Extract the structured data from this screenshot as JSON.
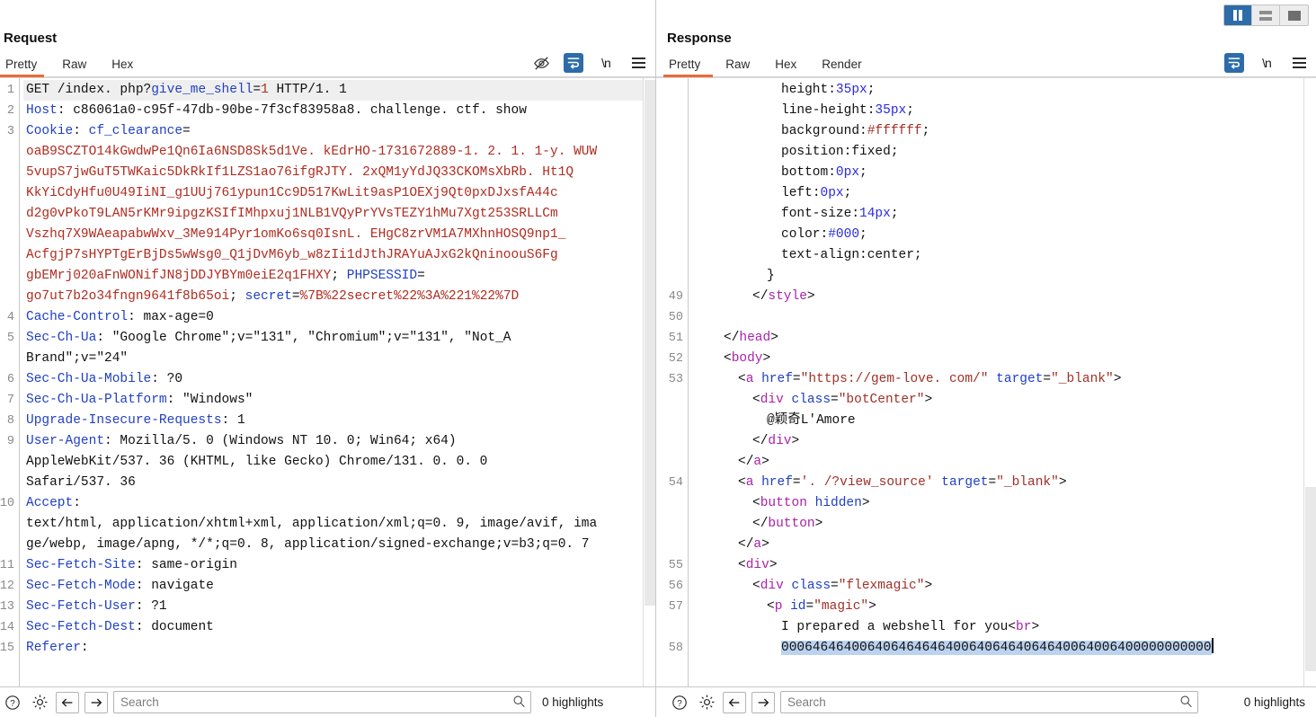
{
  "layout_buttons": [
    {
      "name": "vertical-split",
      "active": true
    },
    {
      "name": "horizontal-split",
      "active": false
    },
    {
      "name": "single-pane",
      "active": false
    }
  ],
  "request": {
    "title": "Request",
    "tabs": [
      {
        "label": "Pretty",
        "active": true
      },
      {
        "label": "Raw",
        "active": false
      },
      {
        "label": "Hex",
        "active": false
      }
    ],
    "toolbar_icons": [
      "eye-off-icon",
      "word-wrap-icon",
      "newline-icon",
      "menu-icon"
    ],
    "newline_label": "\\n",
    "bottom": {
      "search_value": "",
      "search_placeholder": "Search",
      "highlights": "0 highlights"
    },
    "lines": [
      {
        "num": "1",
        "highlight": true,
        "parts": [
          {
            "t": "GET /index. php?",
            "c": "k-plain"
          },
          {
            "t": "give_me_shell",
            "c": "k-blue"
          },
          {
            "t": "=",
            "c": "k-plain"
          },
          {
            "t": "1",
            "c": "k-red"
          },
          {
            "t": " HTTP/1. 1",
            "c": "k-plain"
          }
        ]
      },
      {
        "num": "2",
        "parts": [
          {
            "t": "Host",
            "c": "k-hdr"
          },
          {
            "t": ": c86061a0-c95f-47db-90be-7f3cf83958a8. challenge. ctf. show",
            "c": "k-plain"
          }
        ]
      },
      {
        "num": "3",
        "parts": [
          {
            "t": "Cookie",
            "c": "k-hdr"
          },
          {
            "t": ": ",
            "c": "k-plain"
          },
          {
            "t": "cf_clearance",
            "c": "k-blue"
          },
          {
            "t": "=",
            "c": "k-plain"
          }
        ]
      },
      {
        "num": "",
        "parts": [
          {
            "t": "oaB9SCZTO14kGwdwPe1Qn6Ia6NSD8Sk5d1Ve. kEdrHO-1731672889-1. 2. 1. 1-y. WUW",
            "c": "k-red"
          }
        ]
      },
      {
        "num": "",
        "parts": [
          {
            "t": "5vupS7jwGuT5TWKaic5DkRkIf1LZS1ao76ifgRJTY. 2xQM1yYdJQ33CKOMsXbRb. Ht1Q",
            "c": "k-red"
          }
        ]
      },
      {
        "num": "",
        "parts": [
          {
            "t": "KkYiCdyHfu0U49IiNI_g1UUj761ypun1Cc9D517KwLit9asP1OEXj9Qt0pxDJxsfA44c",
            "c": "k-red"
          }
        ]
      },
      {
        "num": "",
        "parts": [
          {
            "t": "d2g0vPkoT9LAN5rKMr9ipgzKSIfIMhpxuj1NLB1VQyPrYVsTEZY1hMu7Xgt253SRLLCm",
            "c": "k-red"
          }
        ]
      },
      {
        "num": "",
        "parts": [
          {
            "t": "Vszhq7X9WAeapabwWxv_3Me914Pyr1omKo6sq0IsnL. EHgC8zrVM1A7MXhnHOSQ9np1_",
            "c": "k-red"
          }
        ]
      },
      {
        "num": "",
        "parts": [
          {
            "t": "AcfgjP7sHYPTgErBjDs5wWsg0_Q1jDvM6yb_w8zIi1dJthJRAYuAJxG2kQninoouS6Fg",
            "c": "k-red"
          }
        ]
      },
      {
        "num": "",
        "parts": [
          {
            "t": "gbEMrj020aFnWONifJN8jDDJYBYm0eiE2q1FHXY",
            "c": "k-red"
          },
          {
            "t": "; ",
            "c": "k-plain"
          },
          {
            "t": "PHPSESSID",
            "c": "k-blue"
          },
          {
            "t": "=",
            "c": "k-plain"
          }
        ]
      },
      {
        "num": "",
        "parts": [
          {
            "t": "go7ut7b2o34fngn9641f8b65oi",
            "c": "k-red"
          },
          {
            "t": "; ",
            "c": "k-plain"
          },
          {
            "t": "secret",
            "c": "k-blue"
          },
          {
            "t": "=",
            "c": "k-plain"
          },
          {
            "t": "%7B%22secret%22%3A%221%22%7D",
            "c": "k-red"
          }
        ]
      },
      {
        "num": "4",
        "parts": [
          {
            "t": "Cache-Control",
            "c": "k-hdr"
          },
          {
            "t": ": max-age=0",
            "c": "k-plain"
          }
        ]
      },
      {
        "num": "5",
        "parts": [
          {
            "t": "Sec-Ch-Ua",
            "c": "k-hdr"
          },
          {
            "t": ": \"Google Chrome\";v=\"131\", \"Chromium\";v=\"131\", \"Not_A",
            "c": "k-plain"
          }
        ]
      },
      {
        "num": "",
        "parts": [
          {
            "t": "Brand\";v=\"24\"",
            "c": "k-plain"
          }
        ]
      },
      {
        "num": "6",
        "parts": [
          {
            "t": "Sec-Ch-Ua-Mobile",
            "c": "k-hdr"
          },
          {
            "t": ": ?0",
            "c": "k-plain"
          }
        ]
      },
      {
        "num": "7",
        "parts": [
          {
            "t": "Sec-Ch-Ua-Platform",
            "c": "k-hdr"
          },
          {
            "t": ": \"Windows\"",
            "c": "k-plain"
          }
        ]
      },
      {
        "num": "8",
        "parts": [
          {
            "t": "Upgrade-Insecure-Requests",
            "c": "k-hdr"
          },
          {
            "t": ": 1",
            "c": "k-plain"
          }
        ]
      },
      {
        "num": "9",
        "parts": [
          {
            "t": "User-Agent",
            "c": "k-hdr"
          },
          {
            "t": ": Mozilla/5. 0 (Windows NT 10. 0; Win64; x64)",
            "c": "k-plain"
          }
        ]
      },
      {
        "num": "",
        "parts": [
          {
            "t": "AppleWebKit/537. 36 (KHTML, like Gecko) Chrome/131. 0. 0. 0",
            "c": "k-plain"
          }
        ]
      },
      {
        "num": "",
        "parts": [
          {
            "t": "Safari/537. 36",
            "c": "k-plain"
          }
        ]
      },
      {
        "num": "10",
        "parts": [
          {
            "t": "Accept",
            "c": "k-hdr"
          },
          {
            "t": ":",
            "c": "k-plain"
          }
        ]
      },
      {
        "num": "",
        "parts": [
          {
            "t": "text/html, application/xhtml+xml, application/xml;q=0. 9, image/avif, ima",
            "c": "k-plain"
          }
        ]
      },
      {
        "num": "",
        "parts": [
          {
            "t": "ge/webp, image/apng, */*;q=0. 8, application/signed-exchange;v=b3;q=0. 7",
            "c": "k-plain"
          }
        ]
      },
      {
        "num": "11",
        "parts": [
          {
            "t": "Sec-Fetch-Site",
            "c": "k-hdr"
          },
          {
            "t": ": same-origin",
            "c": "k-plain"
          }
        ]
      },
      {
        "num": "12",
        "parts": [
          {
            "t": "Sec-Fetch-Mode",
            "c": "k-hdr"
          },
          {
            "t": ": navigate",
            "c": "k-plain"
          }
        ]
      },
      {
        "num": "13",
        "parts": [
          {
            "t": "Sec-Fetch-User",
            "c": "k-hdr"
          },
          {
            "t": ": ?1",
            "c": "k-plain"
          }
        ]
      },
      {
        "num": "14",
        "parts": [
          {
            "t": "Sec-Fetch-Dest",
            "c": "k-hdr"
          },
          {
            "t": ": document",
            "c": "k-plain"
          }
        ]
      },
      {
        "num": "15",
        "parts": [
          {
            "t": "Referer",
            "c": "k-hdr"
          },
          {
            "t": ":",
            "c": "k-plain"
          }
        ]
      }
    ]
  },
  "response": {
    "title": "Response",
    "tabs": [
      {
        "label": "Pretty",
        "active": true
      },
      {
        "label": "Raw",
        "active": false
      },
      {
        "label": "Hex",
        "active": false
      },
      {
        "label": "Render",
        "active": false
      }
    ],
    "toolbar_icons": [
      "word-wrap-icon",
      "newline-icon",
      "menu-icon"
    ],
    "newline_label": "\\n",
    "bottom": {
      "search_value": "",
      "search_placeholder": "Search",
      "highlights": "0 highlights"
    },
    "lines": [
      {
        "num": "",
        "indent": 6,
        "parts": [
          {
            "t": "height",
            "c": "k-plain"
          },
          {
            "t": ":",
            "c": "k-punct"
          },
          {
            "t": "35px",
            "c": "k-num"
          },
          {
            "t": ";",
            "c": "k-punct"
          }
        ]
      },
      {
        "num": "",
        "indent": 6,
        "parts": [
          {
            "t": "line-height",
            "c": "k-plain"
          },
          {
            "t": ":",
            "c": "k-punct"
          },
          {
            "t": "35px",
            "c": "k-num"
          },
          {
            "t": ";",
            "c": "k-punct"
          }
        ]
      },
      {
        "num": "",
        "indent": 6,
        "parts": [
          {
            "t": "background",
            "c": "k-plain"
          },
          {
            "t": ":",
            "c": "k-punct"
          },
          {
            "t": "#ffffff",
            "c": "k-str"
          },
          {
            "t": ";",
            "c": "k-punct"
          }
        ]
      },
      {
        "num": "",
        "indent": 6,
        "parts": [
          {
            "t": "position",
            "c": "k-plain"
          },
          {
            "t": ":fixed;",
            "c": "k-punct"
          }
        ]
      },
      {
        "num": "",
        "indent": 6,
        "parts": [
          {
            "t": "bottom",
            "c": "k-plain"
          },
          {
            "t": ":",
            "c": "k-punct"
          },
          {
            "t": "0px",
            "c": "k-num"
          },
          {
            "t": ";",
            "c": "k-punct"
          }
        ]
      },
      {
        "num": "",
        "indent": 6,
        "parts": [
          {
            "t": "left",
            "c": "k-plain"
          },
          {
            "t": ":",
            "c": "k-punct"
          },
          {
            "t": "0px",
            "c": "k-num"
          },
          {
            "t": ";",
            "c": "k-punct"
          }
        ]
      },
      {
        "num": "",
        "indent": 6,
        "parts": [
          {
            "t": "font-size",
            "c": "k-plain"
          },
          {
            "t": ":",
            "c": "k-punct"
          },
          {
            "t": "14px",
            "c": "k-num"
          },
          {
            "t": ";",
            "c": "k-punct"
          }
        ]
      },
      {
        "num": "",
        "indent": 6,
        "parts": [
          {
            "t": "color",
            "c": "k-plain"
          },
          {
            "t": ":",
            "c": "k-punct"
          },
          {
            "t": "#000",
            "c": "k-num"
          },
          {
            "t": ";",
            "c": "k-punct"
          }
        ]
      },
      {
        "num": "",
        "indent": 6,
        "parts": [
          {
            "t": "text-align",
            "c": "k-plain"
          },
          {
            "t": ":center;",
            "c": "k-punct"
          }
        ]
      },
      {
        "num": "",
        "indent": 5,
        "parts": [
          {
            "t": "}",
            "c": "k-punct"
          }
        ]
      },
      {
        "num": "49",
        "indent": 4,
        "parts": [
          {
            "t": "</",
            "c": "k-punct"
          },
          {
            "t": "style",
            "c": "k-tag"
          },
          {
            "t": ">",
            "c": "k-punct"
          }
        ]
      },
      {
        "num": "50",
        "indent": 0,
        "parts": []
      },
      {
        "num": "51",
        "indent": 2,
        "parts": [
          {
            "t": "</",
            "c": "k-punct"
          },
          {
            "t": "head",
            "c": "k-tag"
          },
          {
            "t": ">",
            "c": "k-punct"
          }
        ]
      },
      {
        "num": "52",
        "indent": 2,
        "parts": [
          {
            "t": "<",
            "c": "k-punct"
          },
          {
            "t": "body",
            "c": "k-tag"
          },
          {
            "t": ">",
            "c": "k-punct"
          }
        ]
      },
      {
        "num": "53",
        "indent": 3,
        "parts": [
          {
            "t": "<",
            "c": "k-punct"
          },
          {
            "t": "a ",
            "c": "k-tag"
          },
          {
            "t": "href",
            "c": "k-attr"
          },
          {
            "t": "=",
            "c": "k-punct"
          },
          {
            "t": "\"https://gem-love. com/\"",
            "c": "k-str"
          },
          {
            "t": " ",
            "c": "k-punct"
          },
          {
            "t": "target",
            "c": "k-attr"
          },
          {
            "t": "=",
            "c": "k-punct"
          },
          {
            "t": "\"_blank\"",
            "c": "k-str"
          },
          {
            "t": ">",
            "c": "k-punct"
          }
        ]
      },
      {
        "num": "",
        "indent": 4,
        "parts": [
          {
            "t": "<",
            "c": "k-punct"
          },
          {
            "t": "div ",
            "c": "k-tag"
          },
          {
            "t": "class",
            "c": "k-attr"
          },
          {
            "t": "=",
            "c": "k-punct"
          },
          {
            "t": "\"botCenter\"",
            "c": "k-str"
          },
          {
            "t": ">",
            "c": "k-punct"
          }
        ]
      },
      {
        "num": "",
        "indent": 5,
        "parts": [
          {
            "t": "@颖奇L'Amore",
            "c": "k-plain"
          }
        ]
      },
      {
        "num": "",
        "indent": 4,
        "parts": [
          {
            "t": "</",
            "c": "k-punct"
          },
          {
            "t": "div",
            "c": "k-tag"
          },
          {
            "t": ">",
            "c": "k-punct"
          }
        ]
      },
      {
        "num": "",
        "indent": 3,
        "parts": [
          {
            "t": "</",
            "c": "k-punct"
          },
          {
            "t": "a",
            "c": "k-tag"
          },
          {
            "t": ">",
            "c": "k-punct"
          }
        ]
      },
      {
        "num": "54",
        "indent": 3,
        "parts": [
          {
            "t": "<",
            "c": "k-punct"
          },
          {
            "t": "a ",
            "c": "k-tag"
          },
          {
            "t": "href",
            "c": "k-attr"
          },
          {
            "t": "=",
            "c": "k-punct"
          },
          {
            "t": "'. /?view_source'",
            "c": "k-str"
          },
          {
            "t": " ",
            "c": "k-punct"
          },
          {
            "t": "target",
            "c": "k-attr"
          },
          {
            "t": "=",
            "c": "k-punct"
          },
          {
            "t": "\"_blank\"",
            "c": "k-str"
          },
          {
            "t": ">",
            "c": "k-punct"
          }
        ]
      },
      {
        "num": "",
        "indent": 4,
        "parts": [
          {
            "t": "<",
            "c": "k-punct"
          },
          {
            "t": "button ",
            "c": "k-tag"
          },
          {
            "t": "hidden",
            "c": "k-attr"
          },
          {
            "t": ">",
            "c": "k-punct"
          }
        ]
      },
      {
        "num": "",
        "indent": 4,
        "parts": [
          {
            "t": "</",
            "c": "k-punct"
          },
          {
            "t": "button",
            "c": "k-tag"
          },
          {
            "t": ">",
            "c": "k-punct"
          }
        ]
      },
      {
        "num": "",
        "indent": 3,
        "parts": [
          {
            "t": "</",
            "c": "k-punct"
          },
          {
            "t": "a",
            "c": "k-tag"
          },
          {
            "t": ">",
            "c": "k-punct"
          }
        ]
      },
      {
        "num": "55",
        "indent": 3,
        "parts": [
          {
            "t": "<",
            "c": "k-punct"
          },
          {
            "t": "div",
            "c": "k-tag"
          },
          {
            "t": ">",
            "c": "k-punct"
          }
        ]
      },
      {
        "num": "56",
        "indent": 4,
        "parts": [
          {
            "t": "<",
            "c": "k-punct"
          },
          {
            "t": "div ",
            "c": "k-tag"
          },
          {
            "t": "class",
            "c": "k-attr"
          },
          {
            "t": "=",
            "c": "k-punct"
          },
          {
            "t": "\"flexmagic\"",
            "c": "k-str"
          },
          {
            "t": ">",
            "c": "k-punct"
          }
        ]
      },
      {
        "num": "57",
        "indent": 5,
        "parts": [
          {
            "t": "<",
            "c": "k-punct"
          },
          {
            "t": "p ",
            "c": "k-tag"
          },
          {
            "t": "id",
            "c": "k-attr"
          },
          {
            "t": "=",
            "c": "k-punct"
          },
          {
            "t": "\"magic\"",
            "c": "k-str"
          },
          {
            "t": ">",
            "c": "k-punct"
          }
        ]
      },
      {
        "num": "",
        "indent": 6,
        "parts": [
          {
            "t": "I prepared a webshell for you",
            "c": "k-plain"
          },
          {
            "t": "<",
            "c": "k-punct"
          },
          {
            "t": "br",
            "c": "k-tag"
          },
          {
            "t": ">",
            "c": "k-punct"
          }
        ]
      },
      {
        "num": "58",
        "indent": 6,
        "selected": true,
        "parts": [
          {
            "t": "0006464640064064646464006406464064640064006400000000000",
            "c": "k-plain"
          }
        ]
      }
    ]
  }
}
